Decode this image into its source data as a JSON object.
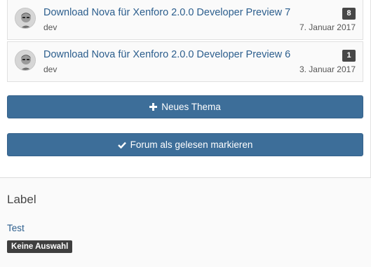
{
  "threads": [
    {
      "title": "Download Nova für Xenforo 2.0.0 Developer Preview 7",
      "author": "dev",
      "date": "7. Januar 2017",
      "count": "8",
      "avatar_icon": "user-avatar-icon"
    },
    {
      "title": "Download Nova für Xenforo 2.0.0 Developer Preview 6",
      "author": "dev",
      "date": "3. Januar 2017",
      "count": "1",
      "avatar_icon": "user-avatar-icon"
    }
  ],
  "actions": {
    "new_thread_label": "Neues Thema",
    "new_thread_icon": "plus-icon",
    "mark_read_label": "Forum als gelesen markieren",
    "mark_read_icon": "check-icon"
  },
  "sidebar": {
    "heading": "Label",
    "link": "Test",
    "tag": "Keine Auswahl"
  },
  "colors": {
    "link": "#2c5e8d",
    "button": "#3d6e99",
    "badge": "#474747"
  }
}
